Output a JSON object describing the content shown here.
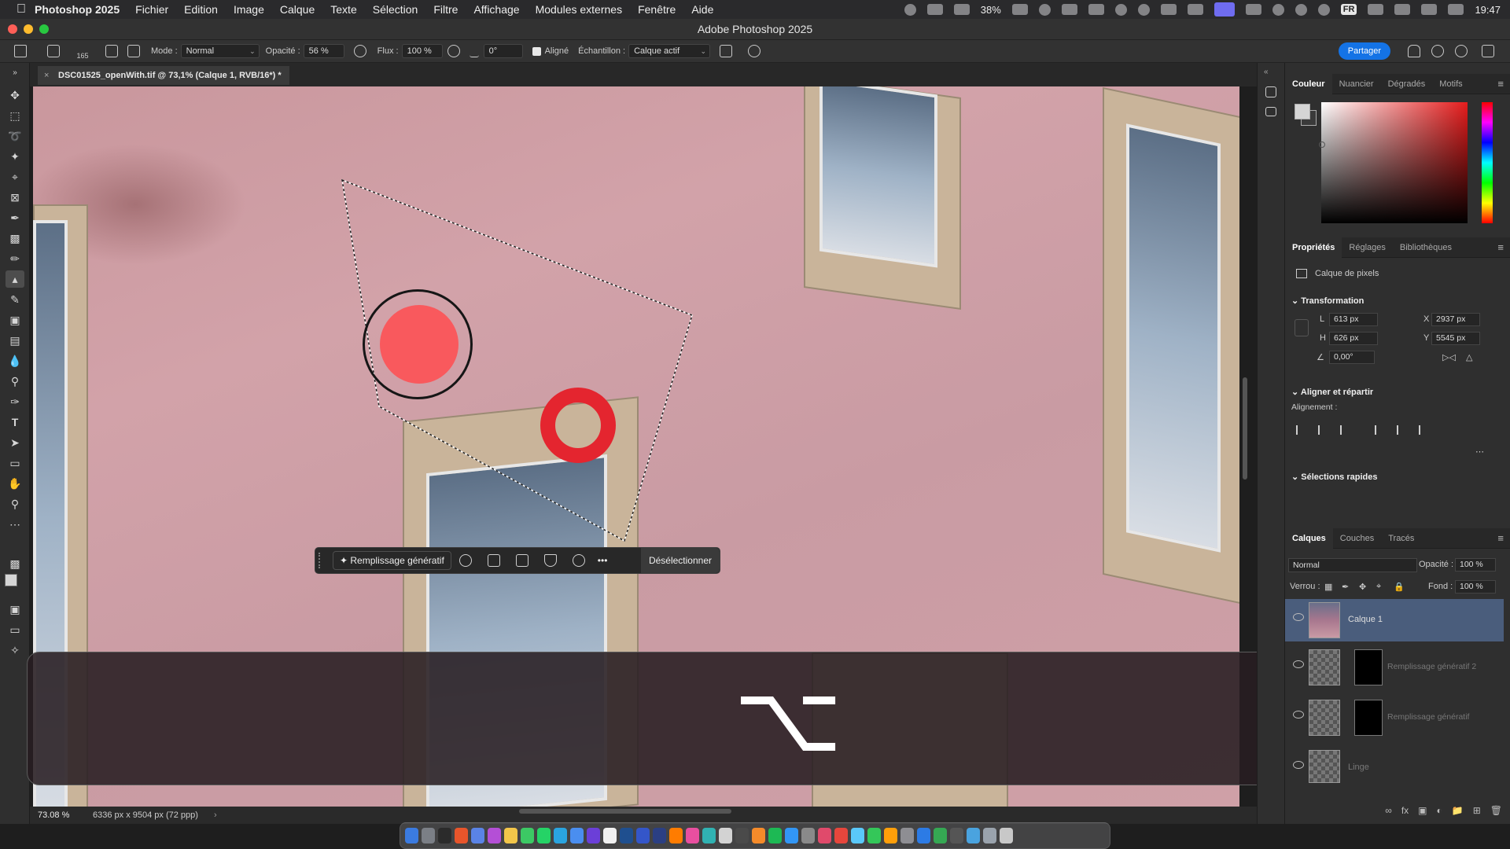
{
  "menubar": {
    "app_name": "Photoshop 2025",
    "items": [
      "Fichier",
      "Edition",
      "Image",
      "Calque",
      "Texte",
      "Sélection",
      "Filtre",
      "Affichage",
      "Modules externes",
      "Fenêtre",
      "Aide"
    ],
    "battery_percent": "38%",
    "input_language": "FR",
    "clock": "19:47"
  },
  "titlebar": {
    "title": "Adobe Photoshop 2025"
  },
  "options": {
    "brush_size": "165",
    "mode_label": "Mode :",
    "mode_value": "Normal",
    "opacity_label": "Opacité :",
    "opacity_value": "56 %",
    "flow_label": "Flux :",
    "flow_value": "100 %",
    "angle_value": "0°",
    "aligned_label": "Aligné",
    "sample_label": "Échantillon :",
    "sample_value": "Calque actif",
    "share_label": "Partager"
  },
  "document": {
    "tab_title": "DSC01525_openWith.tif @ 73,1% (Calque 1, RVB/16*) *",
    "zoom": "73.08 %",
    "dimensions": "6336 px x 9504 px (72 ppp)"
  },
  "taskbar": {
    "generative_fill_label": "Remplissage génératif",
    "more_label": "•••",
    "deselect_label": "Désélectionner"
  },
  "keystroke_overlay": {
    "symbol": "⌥"
  },
  "color_panel": {
    "tabs": [
      "Couleur",
      "Nuancier",
      "Dégradés",
      "Motifs"
    ]
  },
  "properties_panel": {
    "tabs": [
      "Propriétés",
      "Réglages",
      "Bibliothèques"
    ],
    "layer_type": "Calque de pixels",
    "transform_heading": "Transformation",
    "w_label": "L",
    "w_value": "613 px",
    "h_label": "H",
    "h_value": "626 px",
    "x_label": "X",
    "x_value": "2937 px",
    "y_label": "Y",
    "y_value": "5545 px",
    "angle_value": "0,00°",
    "align_heading": "Aligner et répartir",
    "alignment_label": "Alignement :",
    "quick_selections_heading": "Sélections rapides"
  },
  "layers_panel": {
    "tabs": [
      "Calques",
      "Couches",
      "Tracés"
    ],
    "blend_mode": "Normal",
    "opacity_label": "Opacité :",
    "opacity_value": "100 %",
    "lock_label": "Verrou :",
    "fill_label": "Fond :",
    "fill_value": "100 %",
    "layers": [
      {
        "name": "Calque 1"
      },
      {
        "name": "Remplissage génératif 2"
      },
      {
        "name": "Remplissage génératif"
      },
      {
        "name": "Linge"
      }
    ]
  }
}
